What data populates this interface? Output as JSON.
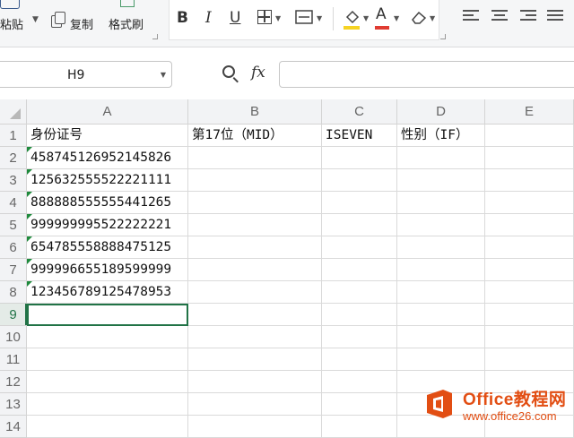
{
  "clipboard": {
    "paste_label": "粘贴",
    "copy_label": "复制",
    "format_painter_label": "格式刷"
  },
  "font_toolbar": {
    "bold": "B",
    "italic": "I",
    "underline": "U",
    "font_color_glyph": "A",
    "fill_color": "#f6d323",
    "font_color": "#e03c32"
  },
  "formula_bar": {
    "name_box_value": "H9",
    "fx_label": "fx",
    "formula_value": ""
  },
  "sheet": {
    "columns": [
      "A",
      "B",
      "C",
      "D",
      "E"
    ],
    "rows": [
      "1",
      "2",
      "3",
      "4",
      "5",
      "6",
      "7",
      "8",
      "9",
      "10",
      "11",
      "12",
      "13",
      "14"
    ],
    "active_row": "9",
    "row1": [
      "身份证号",
      "第17位（MID）",
      "ISEVEN",
      "性别（IF）",
      ""
    ],
    "id_numbers": [
      "458745126952145826",
      "125632555522221111",
      "888888555555441265",
      "999999995522222221",
      "654785558888475125",
      "999996655189599999",
      "123456789125478953"
    ]
  },
  "watermark": {
    "title": "Office教程网",
    "url": "www.office26.com"
  }
}
